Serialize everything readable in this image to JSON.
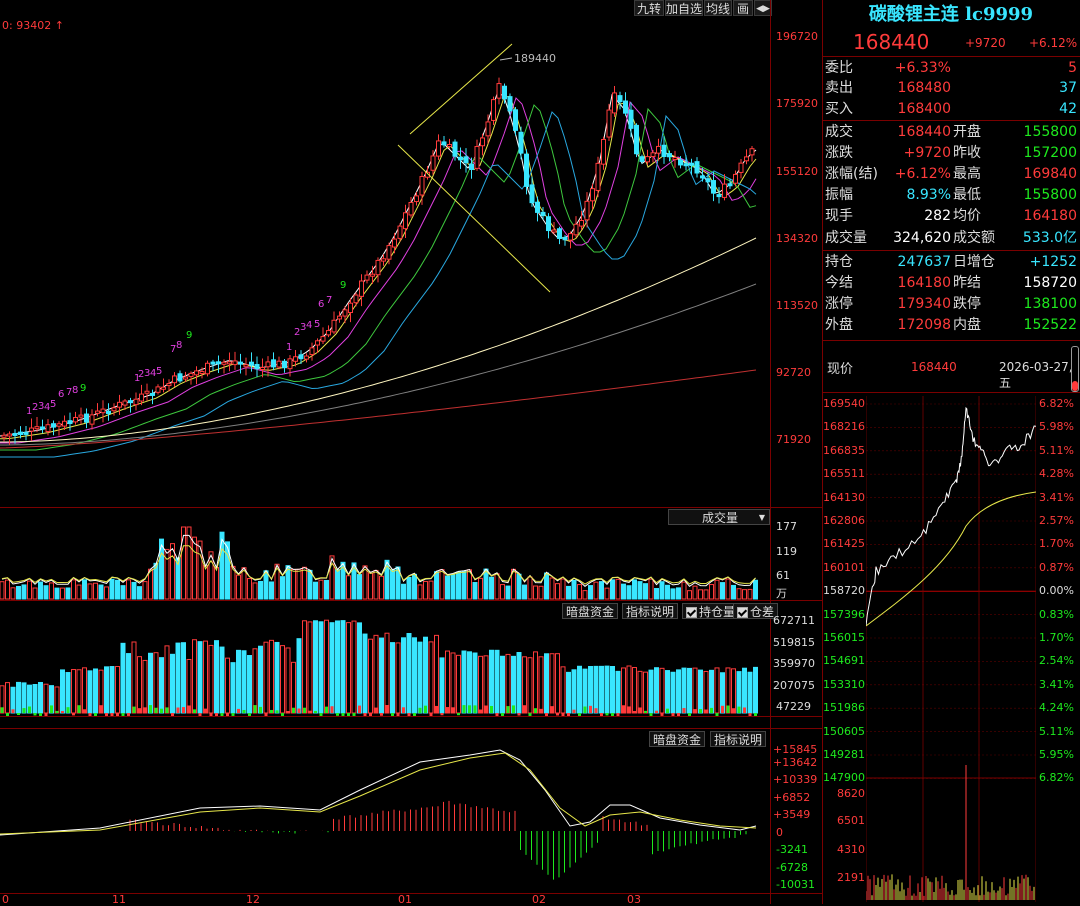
{
  "toolbar": {
    "b1": "九转",
    "b2": "加自选",
    "b3": "均线",
    "b4": "画",
    "b5": "◀▶"
  },
  "top_marker": "0: 93402 ↑",
  "main_chart": {
    "y_ticks": [
      "196720",
      "175920",
      "155120",
      "134320",
      "113520",
      "92720",
      "71920"
    ],
    "peak_label": "189440",
    "x_labels": [
      "0",
      "11",
      "12",
      "01",
      "02",
      "03"
    ]
  },
  "volume_panel": {
    "title": "成交量",
    "y_ticks": [
      "177",
      "119",
      "61",
      "万"
    ]
  },
  "oi_panel": {
    "btn1": "暗盘资金",
    "btn2": "指标说明",
    "chk1": "持仓量",
    "chk2": "仓差",
    "y_ticks": [
      "672711",
      "519815",
      "359970",
      "207075",
      "47229"
    ]
  },
  "macd_panel": {
    "btn1": "暗盘资金",
    "btn2": "指标说明",
    "y_ticks": [
      "+15845",
      "+13642",
      "+10339",
      "+6852",
      "+3549",
      "0",
      "-3241",
      "-6728",
      "-10031"
    ]
  },
  "quote": {
    "title": "碳酸锂主连 lc9999",
    "price": "168440",
    "change": "+9720",
    "change_pct": "+6.12%",
    "rows": [
      {
        "l1": "委比",
        "v1": "+6.33%",
        "v1c": "red",
        "l2": "",
        "v2": "5",
        "v2c": "red"
      },
      {
        "l1": "卖出",
        "v1": "168480",
        "v1c": "red",
        "l2": "",
        "v2": "37",
        "v2c": "cyan"
      },
      {
        "l1": "买入",
        "v1": "168400",
        "v1c": "red",
        "l2": "",
        "v2": "42",
        "v2c": "cyan"
      },
      {
        "l1": "成交",
        "v1": "168440",
        "v1c": "red",
        "l2": "开盘",
        "v2": "155800",
        "v2c": "green"
      },
      {
        "l1": "涨跌",
        "v1": "+9720",
        "v1c": "red",
        "l2": "昨收",
        "v2": "157200",
        "v2c": "green"
      },
      {
        "l1": "涨幅(结)",
        "v1": "+6.12%",
        "v1c": "red",
        "l2": "最高",
        "v2": "169840",
        "v2c": "red"
      },
      {
        "l1": "振幅",
        "v1": "8.93%",
        "v1c": "cyan",
        "l2": "最低",
        "v2": "155800",
        "v2c": "green"
      },
      {
        "l1": "现手",
        "v1": "282",
        "v1c": "white",
        "l2": "均价",
        "v2": "164180",
        "v2c": "red"
      },
      {
        "l1": "成交量",
        "v1": "324,620",
        "v1c": "white",
        "l2": "成交额",
        "v2": "533.0亿",
        "v2c": "cyan"
      },
      {
        "l1": "持仓",
        "v1": "247637",
        "v1c": "cyan",
        "l2": "日增仓",
        "v2": "+1252",
        "v2c": "cyan"
      },
      {
        "l1": "今结",
        "v1": "164180",
        "v1c": "red",
        "l2": "昨结",
        "v2": "158720",
        "v2c": "white"
      },
      {
        "l1": "涨停",
        "v1": "179340",
        "v1c": "red",
        "l2": "跌停",
        "v2": "138100",
        "v2c": "green"
      },
      {
        "l1": "外盘",
        "v1": "172098",
        "v1c": "red",
        "l2": "内盘",
        "v2": "152522",
        "v2c": "green"
      }
    ]
  },
  "intraday": {
    "label": "现价",
    "price": "168440",
    "date": "2026-03-27,五",
    "left_ticks": [
      "169540",
      "168216",
      "166835",
      "165511",
      "164130",
      "162806",
      "161425",
      "160101",
      "158720",
      "157396",
      "156015",
      "154691",
      "153310",
      "151986",
      "150605",
      "149281",
      "147900"
    ],
    "right_ticks": [
      "6.82%",
      "5.98%",
      "5.11%",
      "4.28%",
      "3.41%",
      "2.57%",
      "1.70%",
      "0.87%",
      "0.00%",
      "0.83%",
      "1.70%",
      "2.54%",
      "3.41%",
      "4.24%",
      "5.11%",
      "5.95%",
      "6.82%"
    ],
    "vol_ticks": [
      "8620",
      "6501",
      "4310",
      "2191"
    ]
  },
  "colors": {
    "up": "#ff3b3b",
    "down": "#39e6ff",
    "grid": "#7a0000",
    "green": "#1eea1e"
  }
}
